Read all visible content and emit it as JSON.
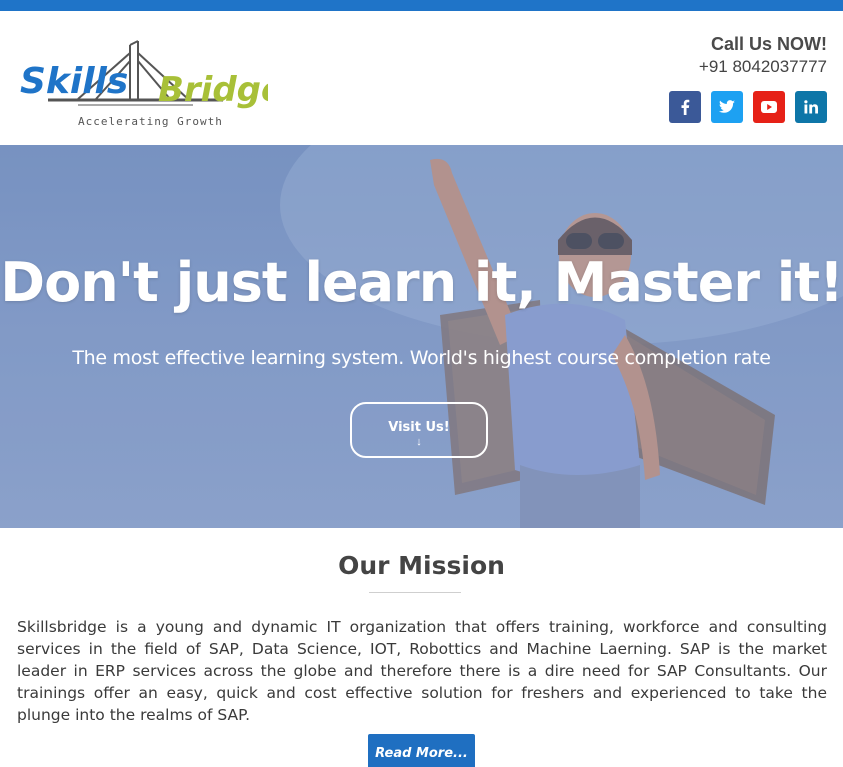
{
  "brand": {
    "logo_text_left": "Skills",
    "logo_text_right": "Bridge",
    "tagline": "Accelerating Growth",
    "colors": {
      "blue": "#1f74c8",
      "green": "#a8c038",
      "gray": "#555555"
    }
  },
  "header": {
    "call_title": "Call Us NOW!",
    "phone": "+91 8042037777",
    "social": [
      {
        "name": "facebook",
        "icon": "facebook-icon",
        "color": "#3b5998"
      },
      {
        "name": "twitter",
        "icon": "twitter-icon",
        "color": "#1da1f2"
      },
      {
        "name": "youtube",
        "icon": "youtube-icon",
        "color": "#e62117"
      },
      {
        "name": "linkedin",
        "icon": "linkedin-icon",
        "color": "#0e76a8"
      }
    ]
  },
  "hero": {
    "title_light": "Don't just learn it, ",
    "title_strong": "Master it!",
    "subtitle": "The most effective learning system. World's highest course completion rate",
    "cta_label": "Visit Us!",
    "cta_arrow": "↓"
  },
  "mission": {
    "title": "Our Mission",
    "body": "Skillsbridge is a young and dynamic IT organization that offers training, workforce and consulting services in the field of SAP, Data Science, IOT, Robottics and Machine Laerning. SAP is the market leader in ERP services across the globe and therefore there is a dire need for SAP Consultants. Our trainings offer an easy, quick and cost effective solution for freshers and experienced to take the plunge into the realms of SAP.",
    "read_more_label": "Read More..."
  }
}
